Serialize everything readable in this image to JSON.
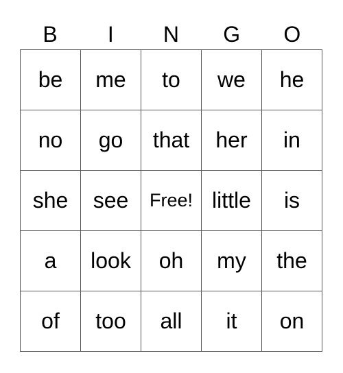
{
  "header": [
    "B",
    "I",
    "N",
    "G",
    "O"
  ],
  "rows": [
    [
      "be",
      "me",
      "to",
      "we",
      "he"
    ],
    [
      "no",
      "go",
      "that",
      "her",
      "in"
    ],
    [
      "she",
      "see",
      "Free!",
      "little",
      "is"
    ],
    [
      "a",
      "look",
      "oh",
      "my",
      "the"
    ],
    [
      "of",
      "too",
      "all",
      "it",
      "on"
    ]
  ]
}
